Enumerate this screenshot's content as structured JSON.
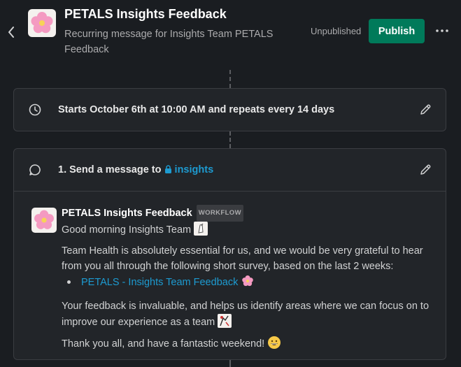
{
  "header": {
    "title": "PETALS Insights Feedback",
    "subtitle": "Recurring message for Insights Team PETALS Feedback",
    "status": "Unpublished",
    "publish_label": "Publish"
  },
  "trigger": {
    "text": "Starts October 6th at 10:00 AM and repeats every 14 days"
  },
  "step": {
    "prefix": "1. Send a message to",
    "channel": "insights"
  },
  "message": {
    "sender": "PETALS Insights Feedback",
    "badge": "WORKFLOW",
    "greeting": "Good morning Insights Team",
    "paragraph1": "Team Health is absolutely essential for us, and we would be very grateful to hear from you all through the following short survey, based on the last 2 weeks:",
    "link": "PETALS - Insights Team Feedback",
    "paragraph2": "Your feedback is invaluable, and helps us identify areas where we can focus on to improve our experience as a team",
    "closing": "Thank you all, and have a fantastic weekend!"
  },
  "colors": {
    "background": "#1a1d21",
    "publish": "#007a5a",
    "link": "#1d9bd1"
  }
}
